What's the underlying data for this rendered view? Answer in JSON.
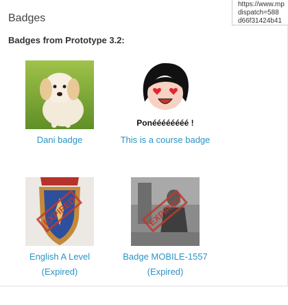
{
  "block": {
    "title": "Badges"
  },
  "section": {
    "title": "Badges from Prototype 3.2:"
  },
  "tooltip": {
    "lines": [
      "https://www.mp",
      "dispatch=588",
      "d66f31424b41"
    ]
  },
  "badges": [
    {
      "name": "Dani badge",
      "status": "",
      "image": "puppy-photo"
    },
    {
      "name": "This is a course badge",
      "status": "",
      "image": "cartoon-heart-eyes",
      "caption": "Ponéééééééé !"
    },
    {
      "name": "English A Level",
      "status": "(Expired)",
      "image": "shield-medal",
      "stamp": "EXPIRED"
    },
    {
      "name": "Badge MOBILE-1557",
      "status": "(Expired)",
      "image": "vintage-photo",
      "stamp": "EXPIRED"
    }
  ],
  "colors": {
    "link": "#2a93c5",
    "stamp": "#c0392b"
  }
}
